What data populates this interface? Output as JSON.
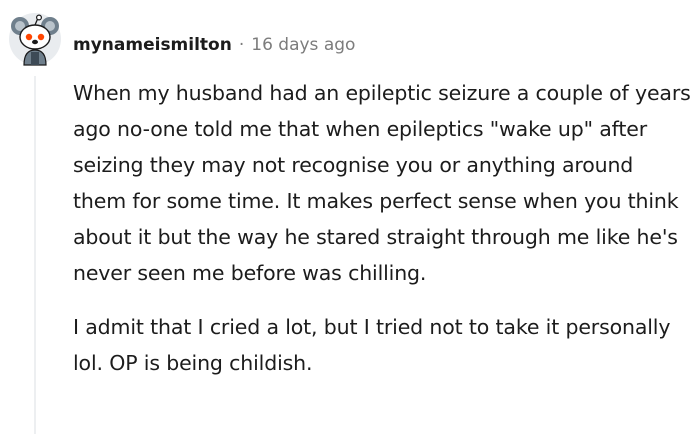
{
  "comment": {
    "username": "mynameismilton",
    "separator": "·",
    "timestamp": "16 days ago",
    "avatar_icon": "snoo-koala-avatar-icon",
    "paragraphs": [
      "When my husband had an epileptic seizure a couple of years ago no-one told me that when epileptics \"wake up\" after seizing they may not recognise you or anything around them for some time. It makes perfect sense when you think about it but the way he stared straight through me like he's never seen me before was chilling.",
      "I admit that I cried a lot, but I tried not to take it personally lol. OP is being childish."
    ]
  },
  "colors": {
    "text": "#1c1c1c",
    "meta": "#7c7c7c",
    "thread_line": "#edeff1"
  }
}
